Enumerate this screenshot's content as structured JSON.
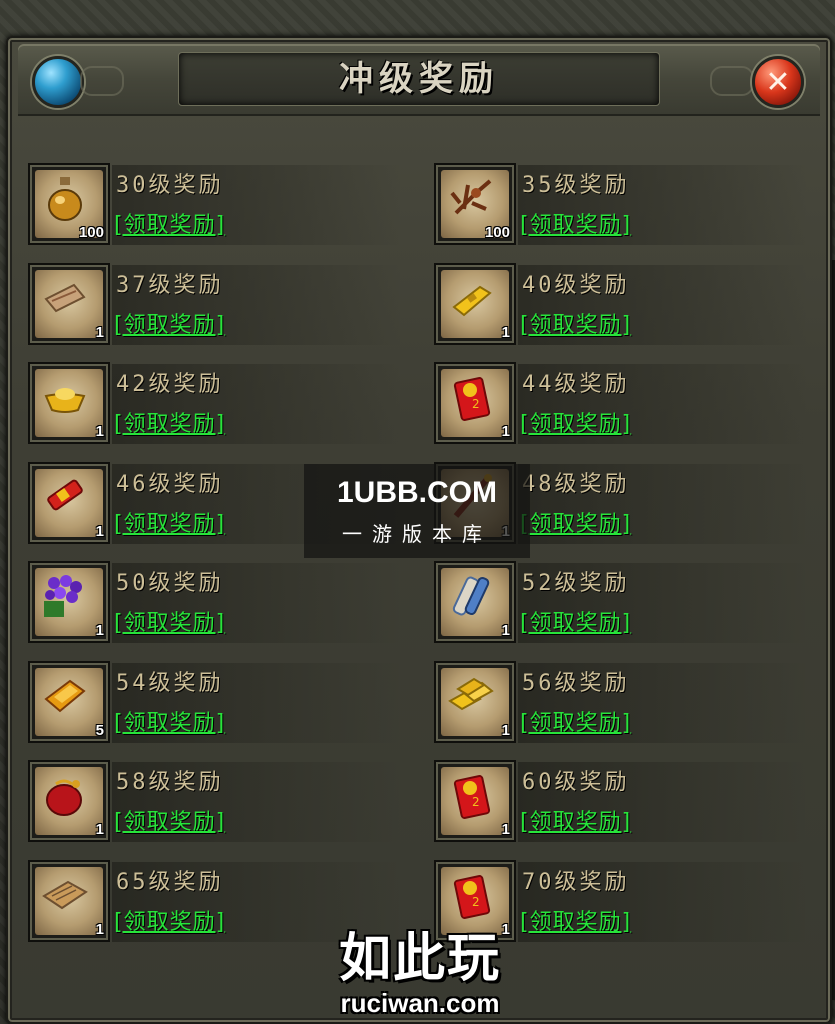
{
  "window": {
    "title": "冲级奖励",
    "close_symbol": "✕"
  },
  "claim_label": "[领取奖励]",
  "rewards": [
    {
      "level_label": "30级奖励",
      "quantity": "100",
      "icon": "potion-bottle-icon"
    },
    {
      "level_label": "35级奖励",
      "quantity": "100",
      "icon": "herb-root-icon"
    },
    {
      "level_label": "37级奖励",
      "quantity": "1",
      "icon": "envelope-letter-icon"
    },
    {
      "level_label": "40级奖励",
      "quantity": "1",
      "icon": "gold-bar-icon"
    },
    {
      "level_label": "42级奖励",
      "quantity": "1",
      "icon": "gold-ingot-icon"
    },
    {
      "level_label": "44级奖励",
      "quantity": "1",
      "icon": "red-envelope-icon"
    },
    {
      "level_label": "46级奖励",
      "quantity": "1",
      "icon": "firecracker-scroll-icon"
    },
    {
      "level_label": "48级奖励",
      "quantity": "1",
      "icon": "red-staff-icon"
    },
    {
      "level_label": "50级奖励",
      "quantity": "1",
      "icon": "purple-flower-bouquet-icon"
    },
    {
      "level_label": "52级奖励",
      "quantity": "1",
      "icon": "blue-scroll-icon"
    },
    {
      "level_label": "54级奖励",
      "quantity": "5",
      "icon": "gold-brick-icon"
    },
    {
      "level_label": "56级奖励",
      "quantity": "1",
      "icon": "gold-bars-stack-icon"
    },
    {
      "level_label": "58级奖励",
      "quantity": "1",
      "icon": "red-pouch-icon"
    },
    {
      "level_label": "60级奖励",
      "quantity": "1",
      "icon": "red-envelope-icon"
    },
    {
      "level_label": "65级奖励",
      "quantity": "1",
      "icon": "book-icon"
    },
    {
      "level_label": "70级奖励",
      "quantity": "1",
      "icon": "red-envelope-icon"
    }
  ],
  "watermark": {
    "main": "1UBB.COM",
    "sub": "一游版本库"
  },
  "logo": {
    "cn": "如此玩",
    "en": "ruciwan.com"
  },
  "colors": {
    "claim_green": "#27e43a",
    "label_tan": "#cdbf98",
    "panel": "#3e3e34"
  }
}
